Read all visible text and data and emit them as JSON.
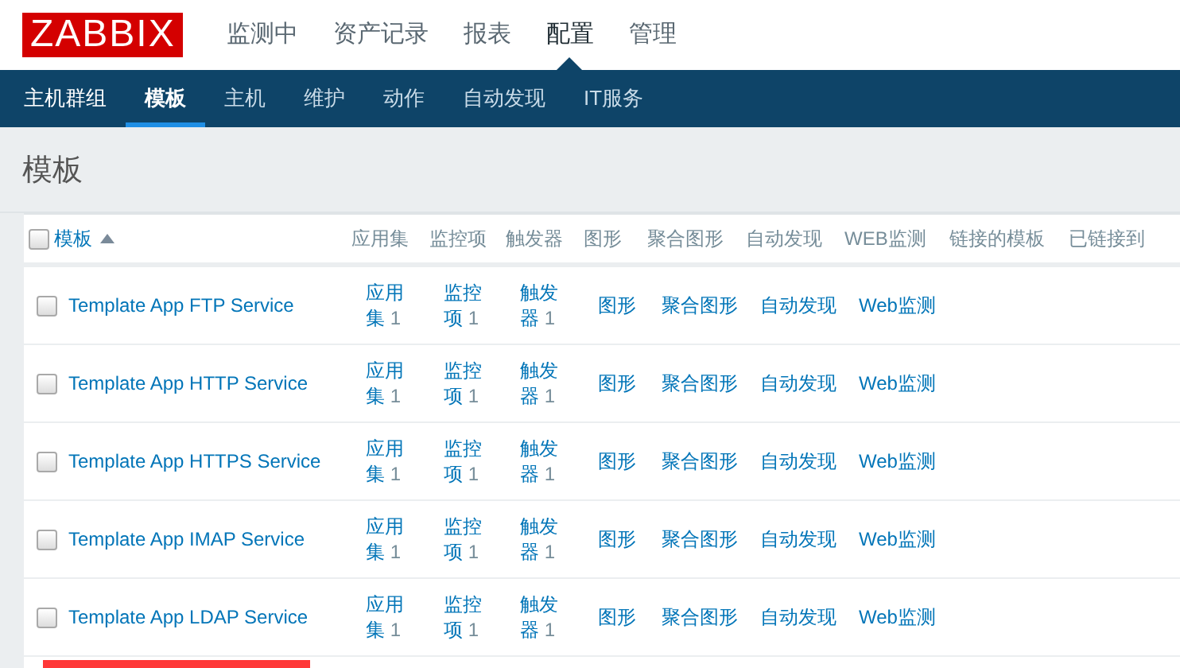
{
  "logo": "ZABBIX",
  "main_menu": [
    {
      "label": "监测中",
      "selected": false
    },
    {
      "label": "资产记录",
      "selected": false
    },
    {
      "label": "报表",
      "selected": false
    },
    {
      "label": "配置",
      "selected": true
    },
    {
      "label": "管理",
      "selected": false
    }
  ],
  "sub_menu": [
    {
      "label": "主机群组",
      "selected": false
    },
    {
      "label": "模板",
      "selected": true
    },
    {
      "label": "主机",
      "selected": false
    },
    {
      "label": "维护",
      "selected": false
    },
    {
      "label": "动作",
      "selected": false
    },
    {
      "label": "自动发现",
      "selected": false
    },
    {
      "label": "IT服务",
      "selected": false
    }
  ],
  "page_title": "模板",
  "table": {
    "select_all_checked": false,
    "columns": [
      {
        "label": "模板",
        "sortable": true
      },
      {
        "label": "应用集",
        "sortable": false
      },
      {
        "label": "监控项",
        "sortable": false
      },
      {
        "label": "触发器",
        "sortable": false
      },
      {
        "label": "图形",
        "sortable": false
      },
      {
        "label": "聚合图形",
        "sortable": false
      },
      {
        "label": "自动发现",
        "sortable": false
      },
      {
        "label": "WEB监测",
        "sortable": false
      },
      {
        "label": "链接的模板",
        "sortable": false
      },
      {
        "label": "已链接到",
        "sortable": false
      }
    ],
    "rows": [
      {
        "checked": false,
        "name": "Template App FTP Service",
        "applications": {
          "label": "应用集",
          "count": "1"
        },
        "items": {
          "label": "监控项",
          "count": "1"
        },
        "triggers": {
          "label": "触发器",
          "count": "1"
        },
        "graphs": "图形",
        "screens": "聚合图形",
        "discovery": "自动发现",
        "web": "Web监测"
      },
      {
        "checked": false,
        "name": "Template App HTTP Service",
        "applications": {
          "label": "应用集",
          "count": "1"
        },
        "items": {
          "label": "监控项",
          "count": "1"
        },
        "triggers": {
          "label": "触发器",
          "count": "1"
        },
        "graphs": "图形",
        "screens": "聚合图形",
        "discovery": "自动发现",
        "web": "Web监测"
      },
      {
        "checked": false,
        "name": "Template App HTTPS Service",
        "applications": {
          "label": "应用集",
          "count": "1"
        },
        "items": {
          "label": "监控项",
          "count": "1"
        },
        "triggers": {
          "label": "触发器",
          "count": "1"
        },
        "graphs": "图形",
        "screens": "聚合图形",
        "discovery": "自动发现",
        "web": "Web监测"
      },
      {
        "checked": false,
        "name": "Template App IMAP Service",
        "applications": {
          "label": "应用集",
          "count": "1"
        },
        "items": {
          "label": "监控项",
          "count": "1"
        },
        "triggers": {
          "label": "触发器",
          "count": "1"
        },
        "graphs": "图形",
        "screens": "聚合图形",
        "discovery": "自动发现",
        "web": "Web监测"
      },
      {
        "checked": false,
        "name": "Template App LDAP Service",
        "applications": {
          "label": "应用集",
          "count": "1"
        },
        "items": {
          "label": "监控项",
          "count": "1"
        },
        "triggers": {
          "label": "触发器",
          "count": "1"
        },
        "graphs": "图形",
        "screens": "聚合图形",
        "discovery": "自动发现",
        "web": "Web监测"
      }
    ]
  }
}
